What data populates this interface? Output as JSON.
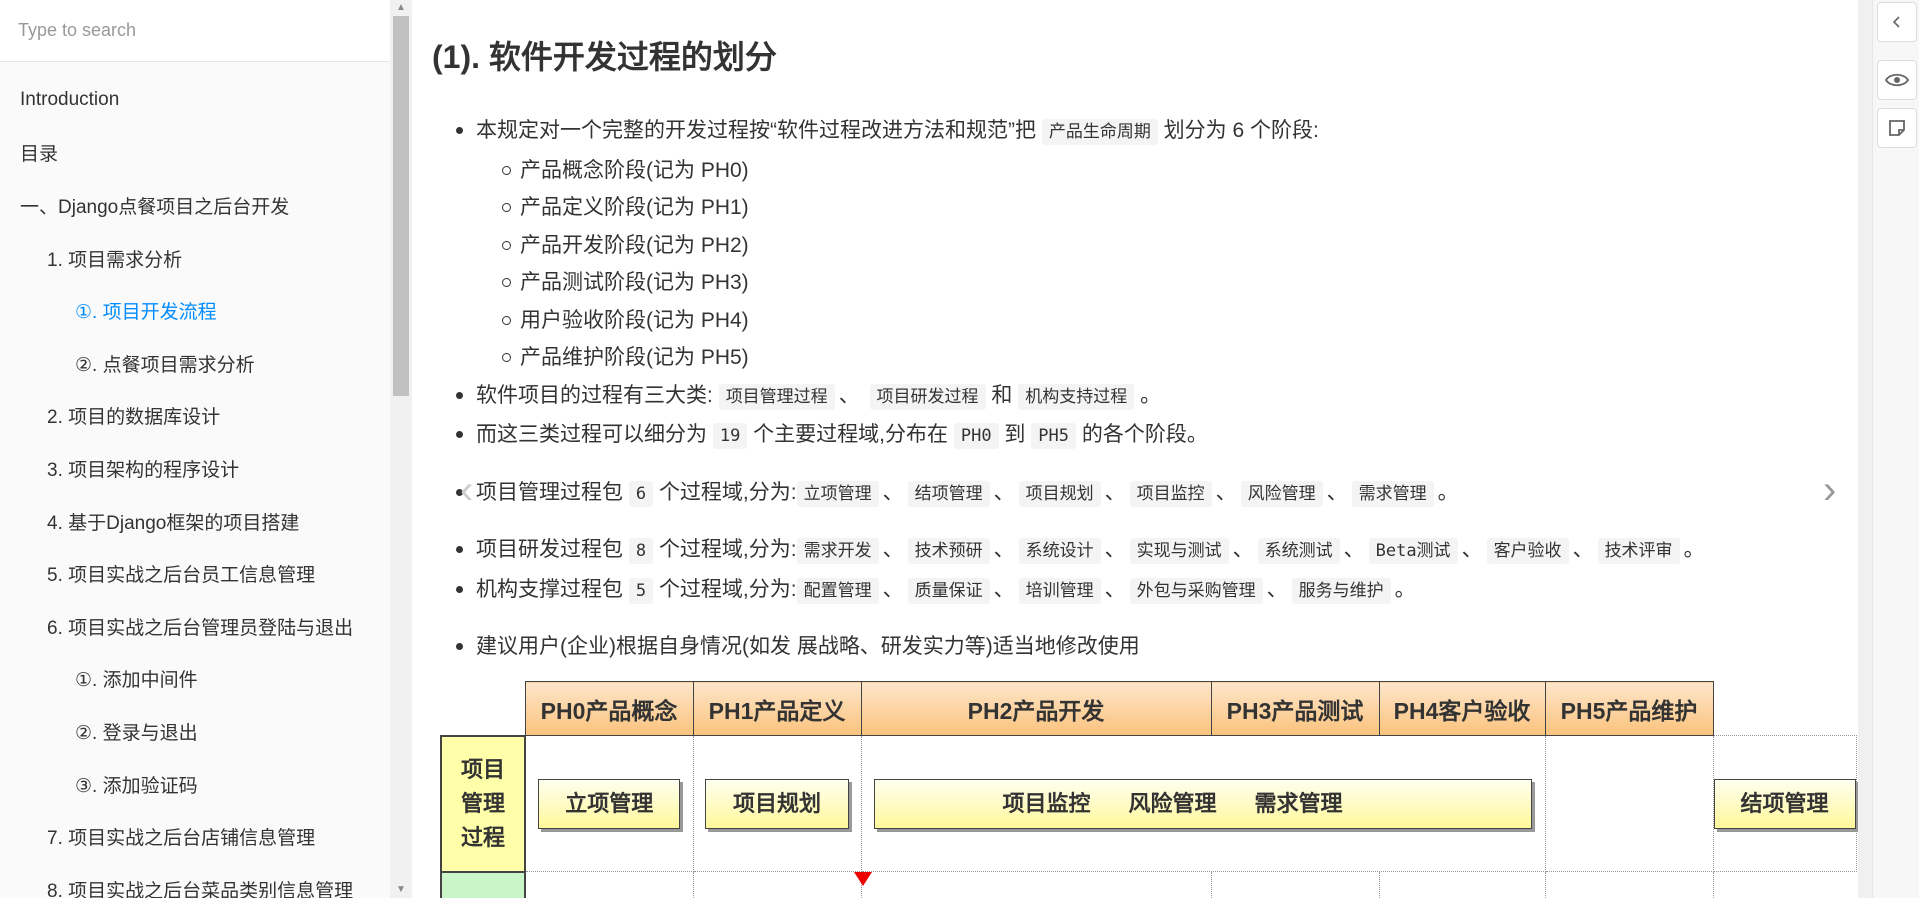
{
  "search": {
    "placeholder": "Type to search"
  },
  "sidebar": {
    "items": [
      {
        "label": "Introduction",
        "level": 0
      },
      {
        "label": "目录",
        "level": 0
      },
      {
        "label": "一、Django点餐项目之后台开发",
        "level": 0
      },
      {
        "label": "1. 项目需求分析",
        "level": 1
      },
      {
        "label": "①. 项目开发流程",
        "level": 2,
        "active": true
      },
      {
        "label": "②. 点餐项目需求分析",
        "level": 2
      },
      {
        "label": "2. 项目的数据库设计",
        "level": 1
      },
      {
        "label": "3. 项目架构的程序设计",
        "level": 1
      },
      {
        "label": "4. 基于Django框架的项目搭建",
        "level": 1
      },
      {
        "label": "5. 项目实战之后台员工信息管理",
        "level": 1
      },
      {
        "label": "6. 项目实战之后台管理员登陆与退出",
        "level": 1
      },
      {
        "label": "①. 添加中间件",
        "level": 2
      },
      {
        "label": "②. 登录与退出",
        "level": 2
      },
      {
        "label": "③. 添加验证码",
        "level": 2
      },
      {
        "label": "7. 项目实战之后台店铺信息管理",
        "level": 1
      },
      {
        "label": "8. 项目实战之后台菜品类别信息管理",
        "level": 1
      }
    ]
  },
  "content": {
    "title": "(1). 软件开发过程的划分",
    "intro": {
      "pre": "本规定对一个完整的开发过程按“软件过程改进方法和规范”把",
      "code": "产品生命周期",
      "post": "划分为 6 个阶段:"
    },
    "phases": [
      "产品概念阶段(记为 PH0)",
      "产品定义阶段(记为 PH1)",
      "产品开发阶段(记为 PH2)",
      "产品测试阶段(记为 PH3)",
      "用户验收阶段(记为 PH4)",
      "产品维护阶段(记为 PH5)"
    ],
    "line2": {
      "pre": "软件项目的过程有三大类:",
      "c1": "项目管理过程",
      "sep1": "、",
      "c2": "项目研发过程",
      "and": "和",
      "c3": "机构支持过程",
      "end": "。"
    },
    "line3": {
      "pre": "而这三类过程可以细分为",
      "c1": "19",
      "mid": "个主要过程域,分布在",
      "c2": "PH0",
      "to": "到",
      "c3": "PH5",
      "end": "的各个阶段。"
    },
    "pm": {
      "pre": "项目管理过程包",
      "count": "6",
      "mid": "个过程域,分为:",
      "items": [
        "立项管理",
        "结项管理",
        "项目规划",
        "项目监控",
        "风险管理",
        "需求管理"
      ],
      "end": "。"
    },
    "rd": {
      "pre": "项目研发过程包",
      "count": "8",
      "mid": "个过程域,分为:",
      "items": [
        "需求开发",
        "技术预研",
        "系统设计",
        "实现与测试",
        "系统测试",
        "Beta测试",
        "客户验收",
        "技术评审"
      ],
      "end": "。"
    },
    "org": {
      "pre": "机构支撑过程包",
      "count": "5",
      "mid": "个过程域,分为:",
      "items": [
        "配置管理",
        "质量保证",
        "培训管理",
        "外包与采购管理",
        "服务与维护"
      ],
      "end": "。"
    },
    "advice": "建议用户(企业)根据自身情况(如发 展战略、研发实力等)适当地修改使用",
    "separator": "、"
  },
  "lifecycle_table": {
    "headers": [
      "PH0产品概念",
      "PH1产品定义",
      "PH2产品开发",
      "PH3产品测试",
      "PH4客户验收",
      "PH5产品维护"
    ],
    "row_label": "项目\n管理\n过程",
    "boxes": {
      "lixiang": "立项管理",
      "guihua": "项目规划",
      "jiankong": "项目监控",
      "fengxian": "风险管理",
      "xuqiu": "需求管理",
      "jiexiang": "结项管理"
    }
  },
  "nav": {
    "prev": "‹",
    "next": "›"
  }
}
